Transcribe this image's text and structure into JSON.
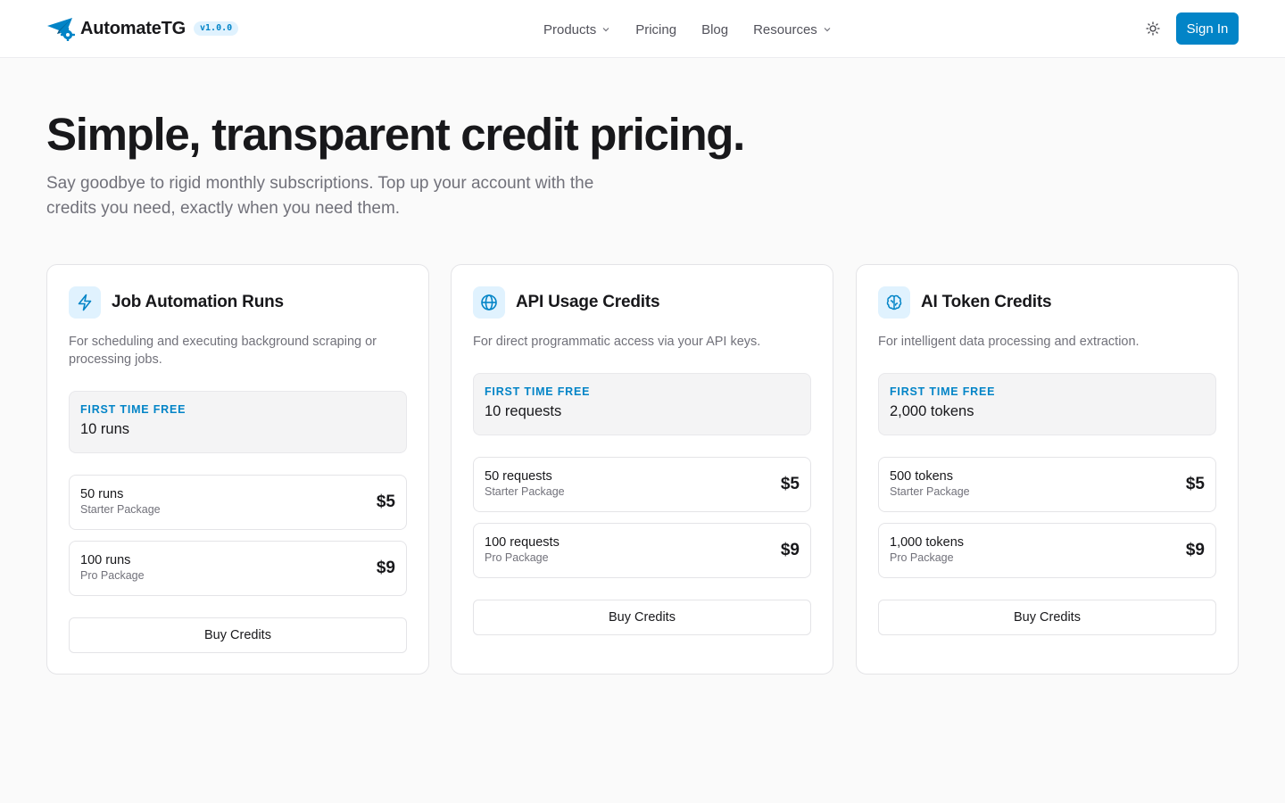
{
  "header": {
    "brand": "AutomateTG",
    "version": "v1.0.0",
    "nav": [
      {
        "label": "Products",
        "icon": "chevron-down-icon"
      },
      {
        "label": "Pricing"
      },
      {
        "label": "Blog"
      },
      {
        "label": "Resources",
        "icon": "chevron-down-icon"
      }
    ],
    "theme_icon": "sun-icon",
    "sign_in": "Sign In"
  },
  "hero": {
    "title": "Simple, transparent credit pricing.",
    "subtitle": "Say goodbye to rigid monthly subscriptions. Top up your account with the credits you need, exactly when you need them."
  },
  "cards": [
    {
      "icon": "lightning-icon",
      "title": "Job Automation Runs",
      "description": "For scheduling and executing background scraping or processing jobs.",
      "free_label": "FIRST TIME FREE",
      "free_value": "10 runs",
      "packages": [
        {
          "amount": "50 runs",
          "name": "Starter Package",
          "price": "$5"
        },
        {
          "amount": "100 runs",
          "name": "Pro Package",
          "price": "$9"
        }
      ],
      "button": "Buy Credits"
    },
    {
      "icon": "globe-icon",
      "title": "API Usage Credits",
      "description": "For direct programmatic access via your API keys.",
      "free_label": "FIRST TIME FREE",
      "free_value": "10 requests",
      "packages": [
        {
          "amount": "50 requests",
          "name": "Starter Package",
          "price": "$5"
        },
        {
          "amount": "100 requests",
          "name": "Pro Package",
          "price": "$9"
        }
      ],
      "button": "Buy Credits"
    },
    {
      "icon": "brain-icon",
      "title": "AI Token Credits",
      "description": "For intelligent data processing and extraction.",
      "free_label": "FIRST TIME FREE",
      "free_value": "2,000 tokens",
      "packages": [
        {
          "amount": "500 tokens",
          "name": "Starter Package",
          "price": "$5"
        },
        {
          "amount": "1,000 tokens",
          "name": "Pro Package",
          "price": "$9"
        }
      ],
      "button": "Buy Credits"
    }
  ],
  "colors": {
    "accent": "#0284c7",
    "accent_soft": "#e0f2fe",
    "text": "#18181b",
    "muted": "#71717a",
    "border": "#e4e4e7",
    "background": "#fafafa"
  }
}
